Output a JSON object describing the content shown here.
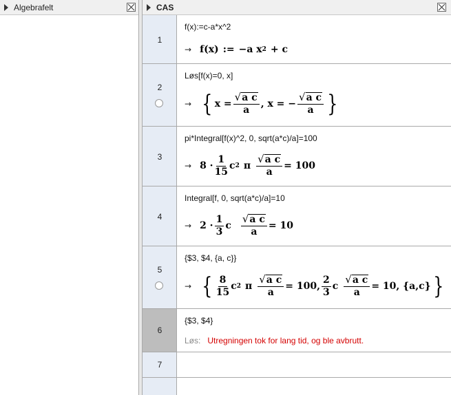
{
  "algebra_panel": {
    "title": "Algebrafelt"
  },
  "cas_panel": {
    "title": "CAS"
  },
  "rows": [
    {
      "n": "1",
      "input": "f(x):=c-a*x^2"
    },
    {
      "n": "2",
      "input": "Løs[f(x)=0, x]"
    },
    {
      "n": "3",
      "input": "pi*Integral[f(x)^2, 0, sqrt(a*c)/a]=100"
    },
    {
      "n": "4",
      "input": "Integral[f, 0, sqrt(a*c)/a]=10"
    },
    {
      "n": "5",
      "input": "{$3, $4, {a, c}}"
    },
    {
      "n": "6",
      "input": "{$3, $4}",
      "error_label": "Løs:",
      "error_text": "Utregningen tok for lang tid, og ble avbrutt."
    },
    {
      "n": "7",
      "input": ""
    },
    {
      "n": "",
      "input": ""
    }
  ],
  "math": {
    "arrow": "→",
    "r1_fx": "f(x)",
    "r1_assign": ":=",
    "r1_rhs": "−a x",
    "r1_exp": "2",
    "r1_tail": "+ c",
    "r2_x1": "x =",
    "r2_comma": ", x = −",
    "sqrt_sym": "√",
    "ac": "a c",
    "a": "a",
    "r3_coef": "8 ·",
    "one": "1",
    "fifteen": "15",
    "c": "c",
    "two": "2",
    "pi": "π",
    "r3_eq": "= 100",
    "r4_coef": "2 ·",
    "three": "3",
    "r4_eq": "= 10",
    "r5_eq1": "= 100,",
    "r5_eq2": "= 10, {a,c}",
    "eight": "8"
  }
}
